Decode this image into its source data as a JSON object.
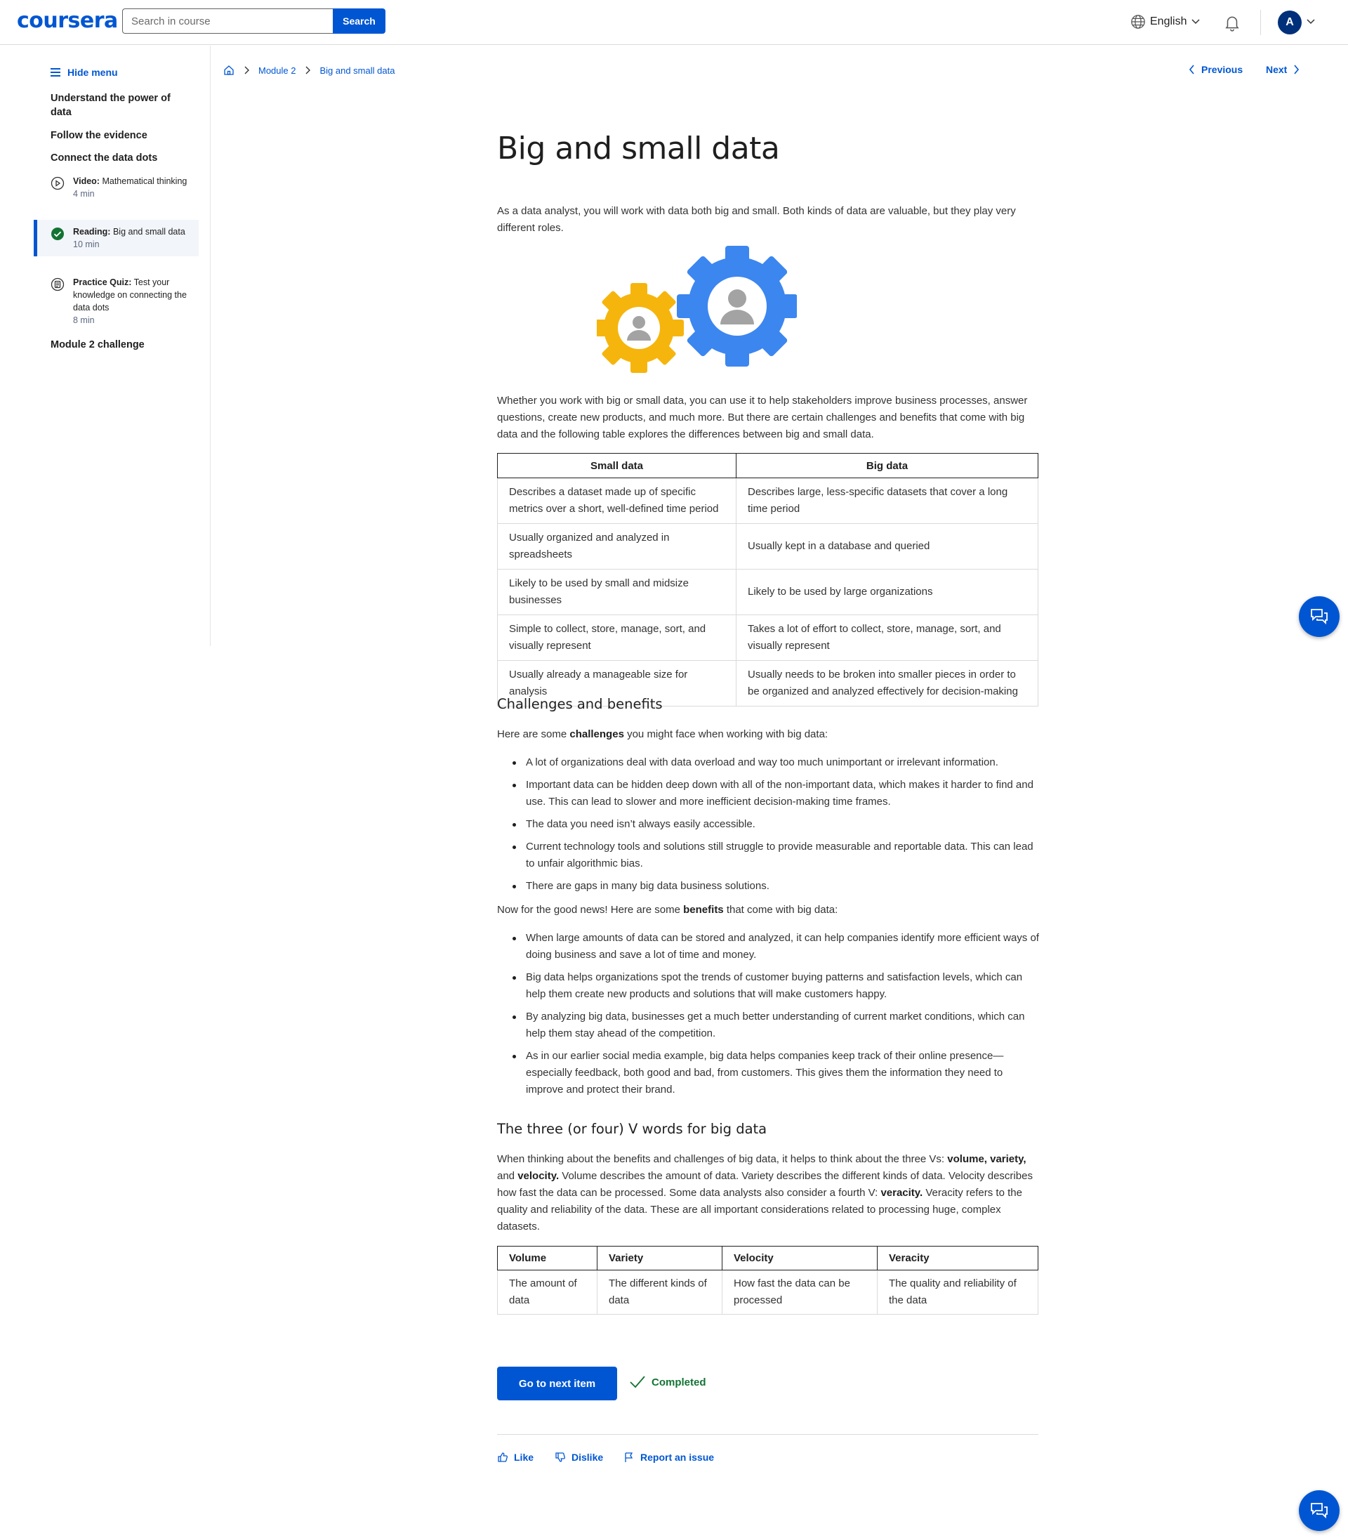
{
  "header": {
    "logo": "coursera",
    "search_placeholder": "Search in course",
    "search_button": "Search",
    "language": "English",
    "avatar_letter": "A"
  },
  "sidebar": {
    "hide_menu": "Hide menu",
    "sections": [
      "Understand the power of data",
      "Follow the evidence",
      "Connect the data dots",
      "Module 2 challenge"
    ],
    "items": [
      {
        "type": "Video:",
        "title": "Mathematical thinking",
        "duration": "4 min",
        "icon": "play-circle-icon"
      },
      {
        "type": "Reading:",
        "title": "Big and small data",
        "duration": "10 min",
        "icon": "check-circle-icon"
      },
      {
        "type": "Practice Quiz:",
        "title": "Test your knowledge on connecting the data dots",
        "duration": "8 min",
        "icon": "quiz-icon"
      }
    ]
  },
  "breadcrumb": {
    "home_icon": "home-icon",
    "module": "Module 2",
    "page": "Big and small data"
  },
  "nav": {
    "previous": "Previous",
    "next": "Next"
  },
  "article": {
    "title": "Big and small data",
    "intro": "As a data analyst, you will work with data both big and small. Both kinds of data are valuable, but they play very different roles.",
    "paragraph2": "Whether you work with big or small data, you can use it to help stakeholders improve business processes, answer questions, create new products, and much more. But there are certain challenges and benefits that come with big data and the following table explores the differences between big and small data.",
    "table1": {
      "headers": [
        "Small data",
        "Big data"
      ],
      "rows": [
        [
          "Describes a dataset made up of specific metrics over a short, well-defined time period",
          "Describes large, less-specific datasets that cover a long time period"
        ],
        [
          "Usually organized and analyzed in spreadsheets",
          "Usually kept in a database and queried"
        ],
        [
          "Likely to be used by small and midsize businesses",
          "Likely to be used by large organizations"
        ],
        [
          "Simple to collect, store, manage, sort, and visually represent",
          "Takes a lot of effort to collect, store, manage, sort, and visually represent"
        ],
        [
          "Usually already a manageable size for analysis",
          "Usually needs to be broken into smaller pieces in order to be organized and analyzed effectively for decision-making"
        ]
      ]
    },
    "h_challenges": "Challenges and benefits",
    "challenges_intro_a": "Here are some ",
    "challenges_intro_b": "challenges",
    "challenges_intro_c": " you might face when working with big data:",
    "challenges": [
      "A lot of organizations deal with data overload and way too much unimportant or irrelevant information.",
      "Important data can be hidden deep down with all of the non-important data, which makes it harder to find and use. This can lead to slower and more inefficient decision-making time frames.",
      "The data you need isn’t always easily accessible.",
      "Current technology tools and solutions still struggle to provide measurable and reportable data. This can lead to unfair algorithmic bias.",
      "There are gaps in many big data business solutions."
    ],
    "benefits_intro_a": "Now for the good news! Here are some ",
    "benefits_intro_b": "benefits",
    "benefits_intro_c": " that come with big data:",
    "benefits": [
      "When large amounts of data can be stored and analyzed, it can help companies identify more efficient ways of doing business and save a lot of time and money.",
      "Big data helps organizations spot the trends of customer buying patterns and satisfaction levels, which can help them create new products and solutions that will make customers happy.",
      "By analyzing big data, businesses get a much better understanding of current market conditions, which can help them stay ahead of the competition.",
      "As in our earlier social media example, big data helps companies keep track of their online presence—especially feedback, both good and bad, from customers. This gives them the information they need to improve and protect their brand."
    ],
    "h_vwords": "The three (or four) V words for big data",
    "v_p1": "When thinking about the benefits and challenges of big data, it helps to think about the three Vs: ",
    "v_b1": "volume, variety,",
    "v_p2": " and ",
    "v_b2": "velocity.",
    "v_p3": " Volume describes the amount of data. Variety describes the different kinds of data. Velocity describes how fast the data can be processed. Some data analysts also consider a fourth V: ",
    "v_b3": "veracity.",
    "v_p4": " Veracity refers to the quality and reliability of the data. These are all important considerations related to processing huge, complex datasets.",
    "table2": {
      "headers": [
        "Volume",
        "Variety",
        "Velocity",
        "Veracity"
      ],
      "row": [
        "The amount of data",
        "The different kinds of data",
        "How fast the data can be processed",
        "The quality and reliability of the data"
      ]
    }
  },
  "footer": {
    "next_button": "Go to next item",
    "completed": "Completed",
    "like": "Like",
    "dislike": "Dislike",
    "report": "Report an issue"
  },
  "colors": {
    "primary": "#0056d2",
    "success": "#137333",
    "gear_yellow": "#f6b50d",
    "gear_blue": "#3c86f0"
  }
}
